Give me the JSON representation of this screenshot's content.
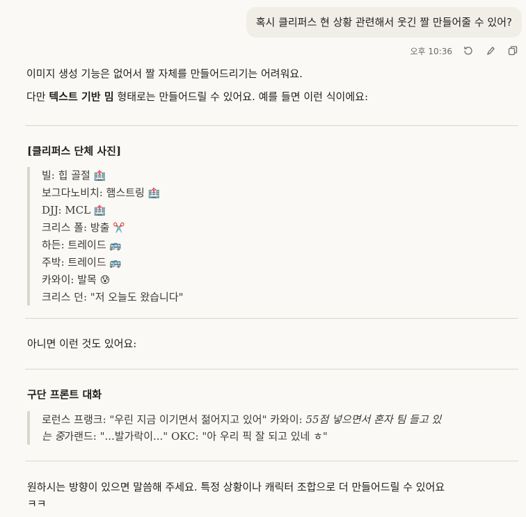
{
  "user_message": "혹시 클리퍼스 현 상황 관련해서 웃긴 짤 만들어줄 수 있어?",
  "meta": {
    "time": "오후 10:36",
    "retry_icon": "retry-icon",
    "edit_icon": "edit-icon",
    "copy_icon": "copy-icon"
  },
  "reply": {
    "p1": "이미지 생성 기능은 없어서 짤 자체를 만들어드리기는 어려워요.",
    "p2_prefix": "다만 ",
    "p2_bold": "텍스트 기반 밈",
    "p2_suffix": " 형태로는 만들어드릴 수 있어요. 예를 들면 이런 식이에요:",
    "section1_title": "[클리퍼스 단체 사진]",
    "section1_lines": [
      {
        "text": "빌: 힙 골절 ",
        "emoji": "🏥"
      },
      {
        "text": "보그다노비치: 햄스트링 ",
        "emoji": "🏥"
      },
      {
        "text": "DJJ: MCL ",
        "emoji": "🏥"
      },
      {
        "text": "크리스 폴: 방출 ",
        "emoji": "✂️"
      },
      {
        "text": "하든: 트레이드 ",
        "emoji": "🚌"
      },
      {
        "text": "주박: 트레이드 ",
        "emoji": "🚌"
      },
      {
        "text": "카와이: 발목 ",
        "emoji": "😰"
      },
      {
        "text": "크리스 던: \"저 오늘도 왔습니다\"",
        "emoji": ""
      }
    ],
    "p3": "아니면 이런 것도 있어요:",
    "section2_title": "구단 프론트 대화",
    "section2_line1_a": "로런스 프랭크: \"우린 지금 이기면서 젊어지고 있어\" 카와이: ",
    "section2_line1_b": "55점 넣으면서 혼자 팀 들고 있",
    "section2_line2_a": "는 중",
    "section2_line2_b": "가랜드: \"...발가락이...\" OKC: \"아 우리 픽 잘 되고 있네 ㅎ\"",
    "p4_line1": "원하시는 방향이 있으면 말씀해 주세요. 특정 상황이나 캐릭터 조합으로 더 만들어드릴 수 있어요",
    "p4_line2": "ㅋㅋ"
  }
}
